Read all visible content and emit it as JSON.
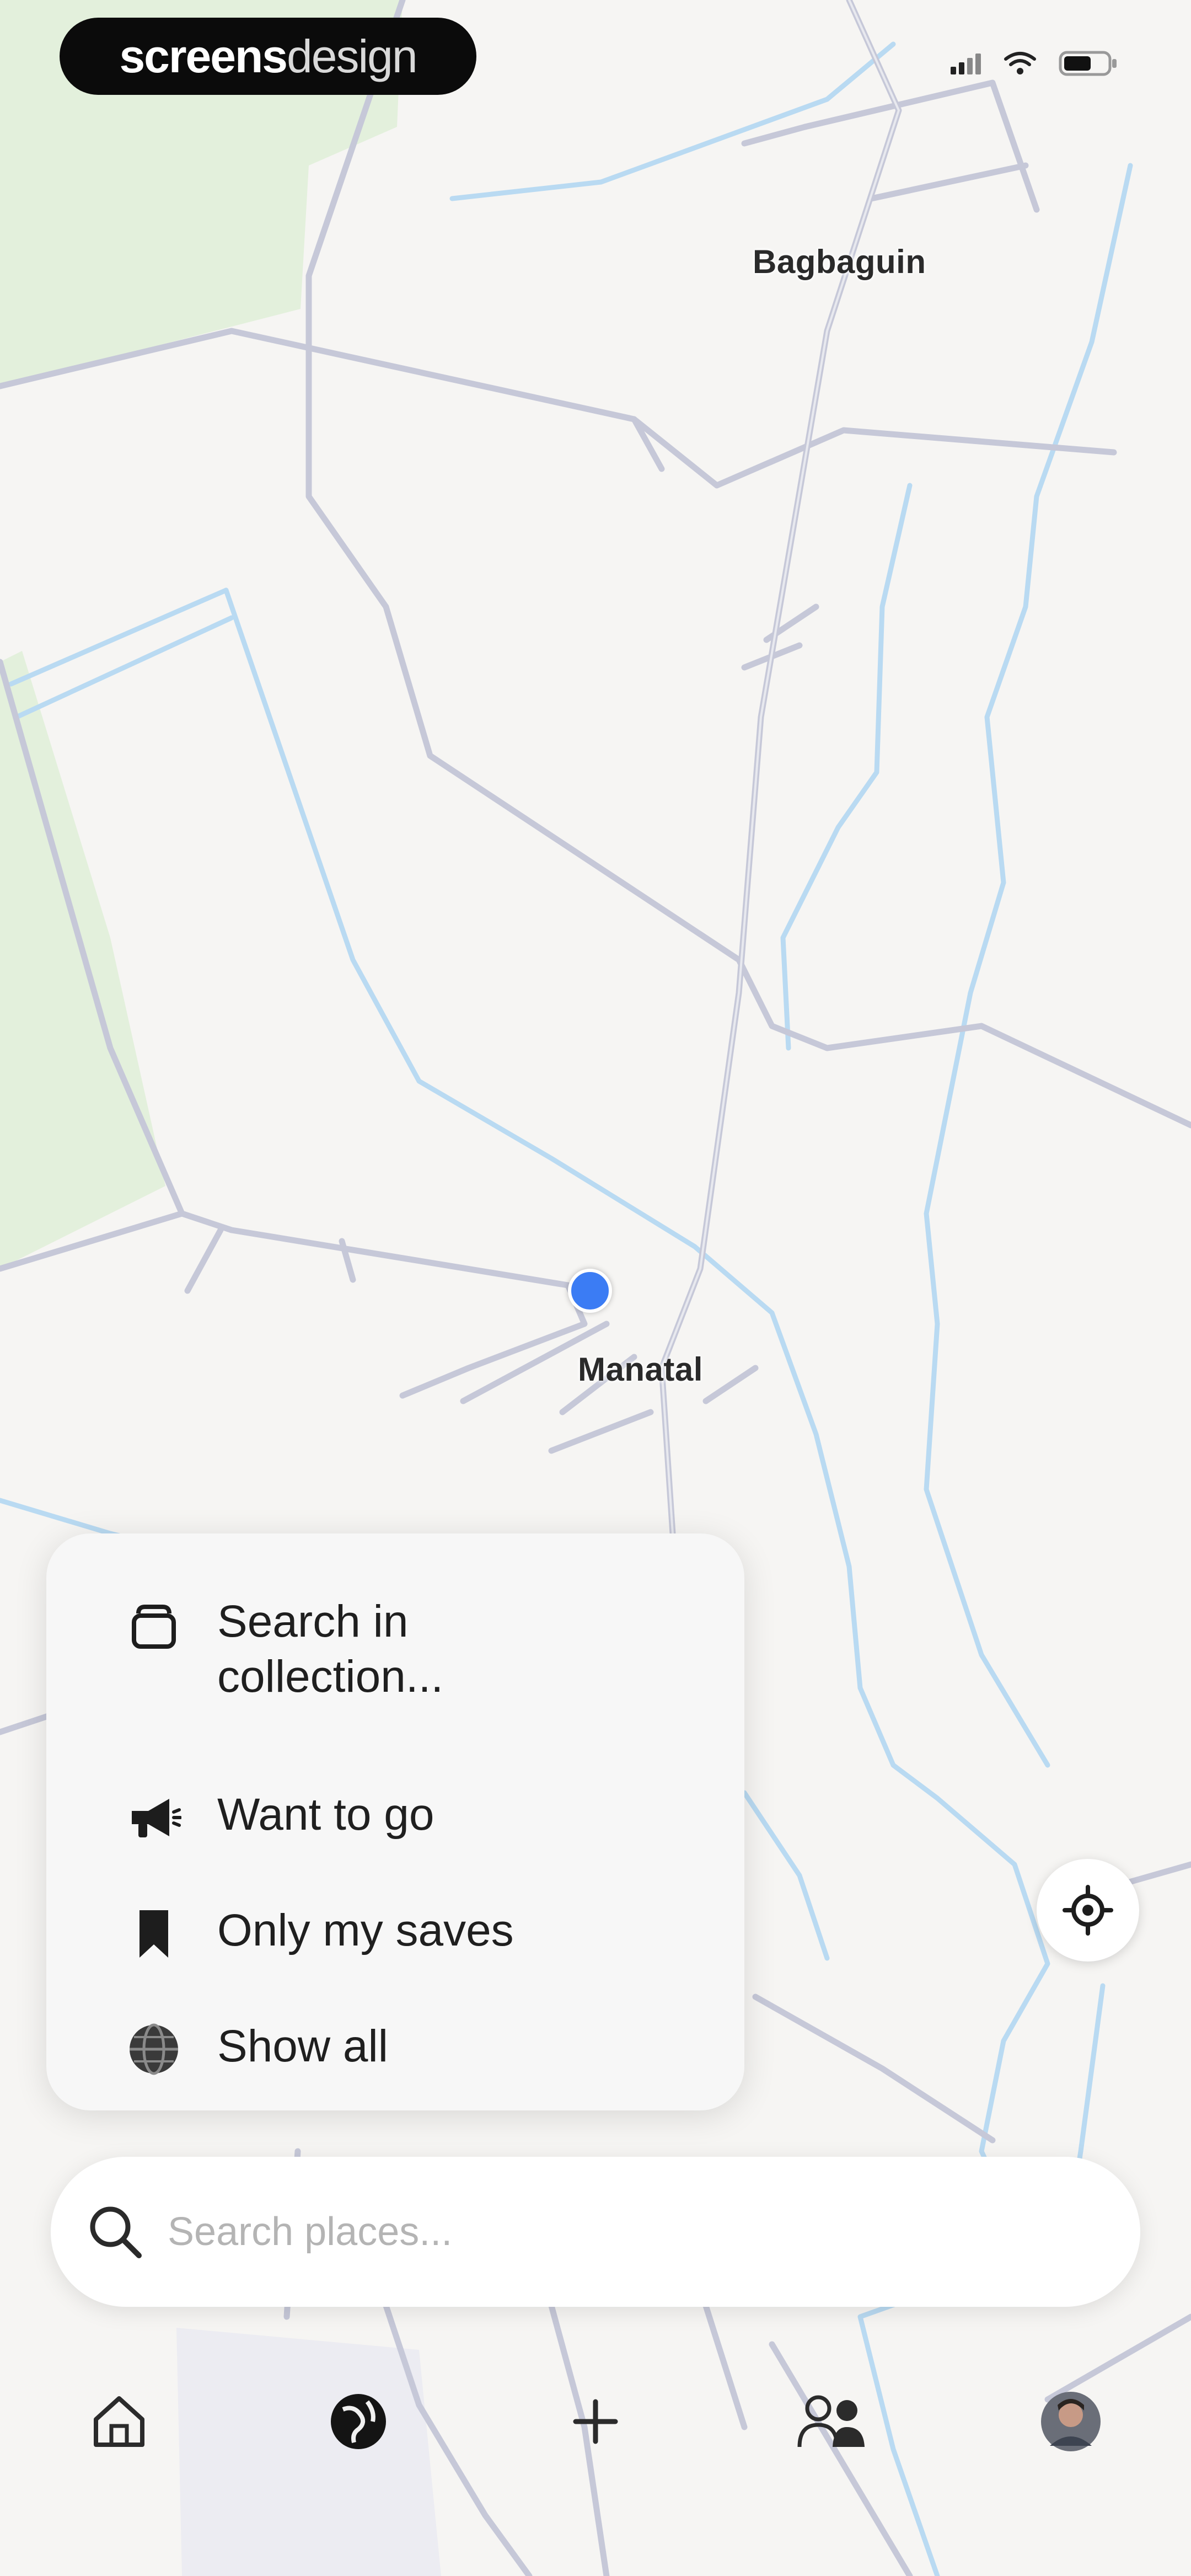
{
  "brand": {
    "bold": "screens",
    "light": "design"
  },
  "status_bar": {
    "signal_icon": "signal-icon",
    "wifi_icon": "wifi-icon",
    "battery_icon": "battery-icon"
  },
  "map": {
    "places": [
      "Bagbaguin",
      "Manatal"
    ],
    "colors": {
      "land": "#f6f5f3",
      "park": "#e3f0dc",
      "road": "#c6c8d8",
      "water": "#b9daf2",
      "location": "#3b7cf4"
    }
  },
  "filter_menu": {
    "items": [
      {
        "label": "Search in collection...",
        "icon": "collection-icon"
      },
      {
        "label": "Want to go",
        "icon": "megaphone-icon"
      },
      {
        "label": "Only my saves",
        "icon": "bookmark-icon"
      },
      {
        "label": "Show all",
        "icon": "globe-icon"
      }
    ]
  },
  "search": {
    "placeholder": "Search places..."
  },
  "tab_bar": {
    "tabs": [
      {
        "icon": "home-icon"
      },
      {
        "icon": "explore-globe-icon"
      },
      {
        "icon": "plus-icon"
      },
      {
        "icon": "friends-icon"
      },
      {
        "icon": "profile-avatar-icon"
      }
    ]
  }
}
